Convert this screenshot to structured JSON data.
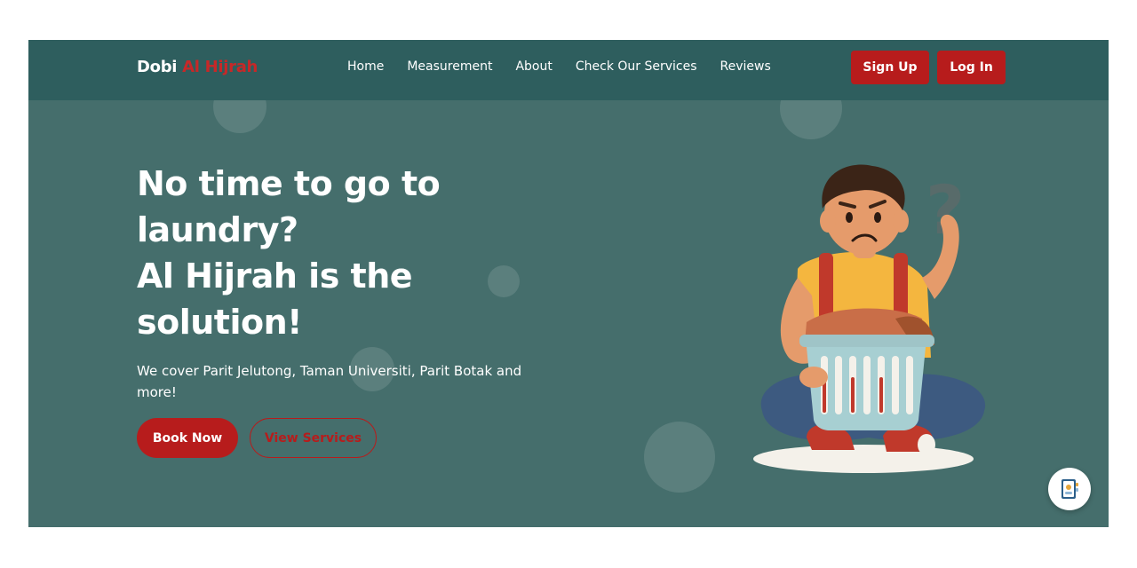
{
  "brand": {
    "name_part1": "Dobi",
    "name_part2": "Al Hijrah"
  },
  "nav": {
    "links": [
      "Home",
      "Measurement",
      "About",
      "Check Our Services",
      "Reviews"
    ],
    "signup_label": "Sign Up",
    "login_label": "Log In"
  },
  "hero": {
    "title_line1": "No time to go to",
    "title_line2": "laundry?",
    "title_line3": "Al Hijrah is the",
    "title_line4": "solution!",
    "subtitle": "We cover Parit Jelutong, Taman Universiti, Parit Botak and more!",
    "book_label": "Book Now",
    "view_label": "View Services",
    "illustration_icon": "confused-man-laundry-basket-illustration"
  },
  "floating": {
    "chat_icon": "contact-book-icon"
  },
  "colors": {
    "background": "#456e6c",
    "navbar": "#2e5e5e",
    "accent": "#b71c1c",
    "text": "#ffffff"
  }
}
